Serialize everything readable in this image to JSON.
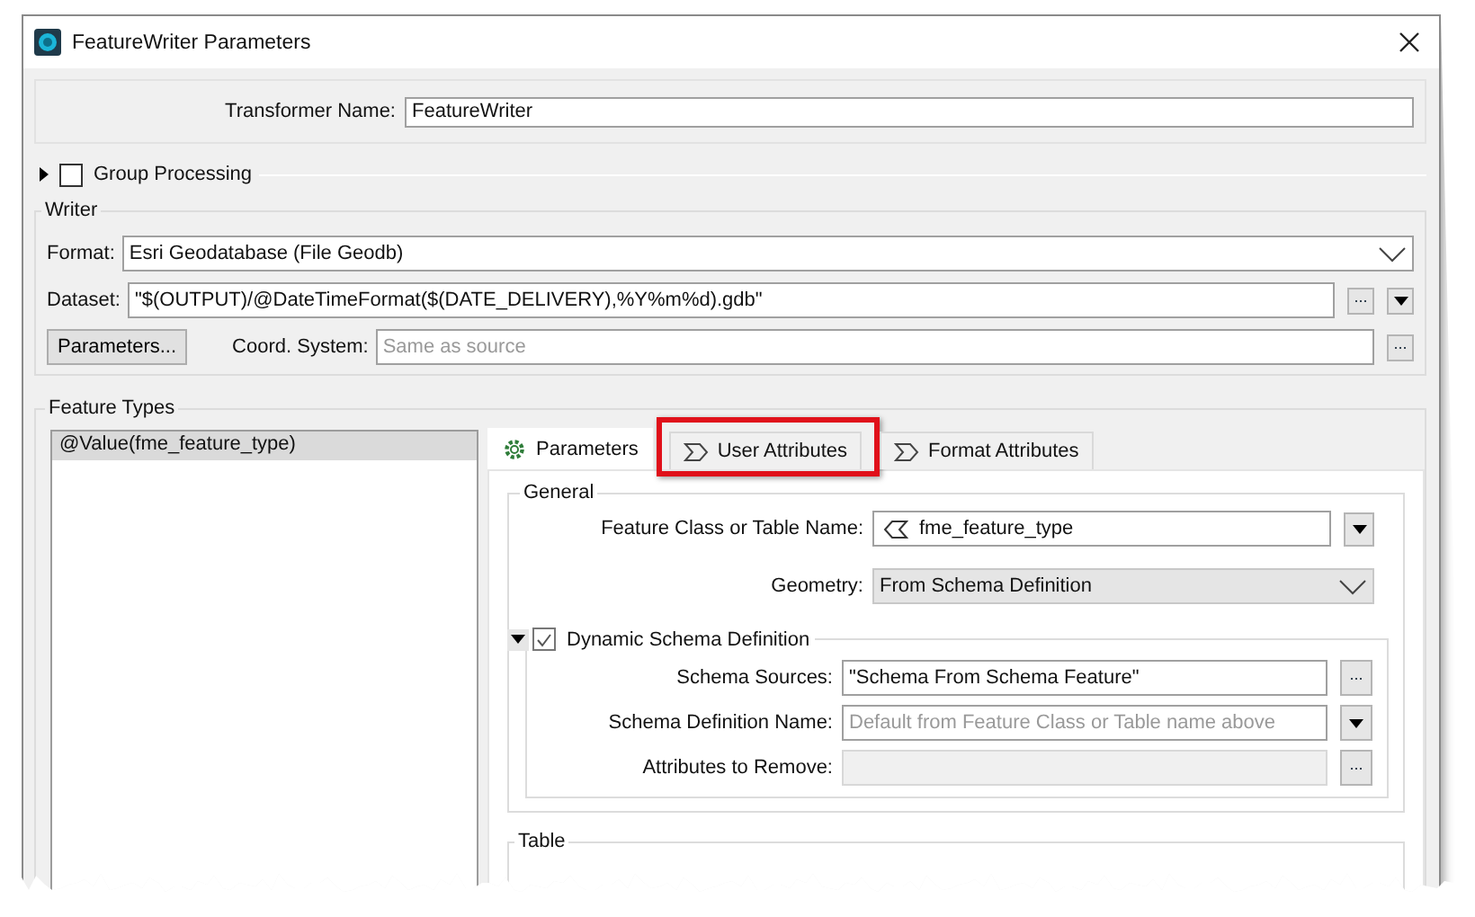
{
  "window": {
    "title": "FeatureWriter Parameters"
  },
  "transformer_name": {
    "label": "Transformer Name:",
    "value": "FeatureWriter"
  },
  "group_processing": {
    "label": "Group Processing",
    "checked": false,
    "expanded": false
  },
  "writer": {
    "title": "Writer",
    "format": {
      "label": "Format:",
      "value": "Esri Geodatabase (File Geodb)",
      "chevron": true
    },
    "dataset": {
      "label": "Dataset:",
      "value": "\"$(OUTPUT)/@DateTimeFormat($(DATE_DELIVERY),%Y%m%d).gdb\"",
      "browse": "...",
      "menu": true
    },
    "parameters_button": "Parameters...",
    "coord_system": {
      "label": "Coord. System:",
      "placeholder": "Same as source",
      "browse": "..."
    }
  },
  "feature_types": {
    "title": "Feature Types",
    "items": [
      {
        "label": "@Value(fme_feature_type)",
        "selected": true
      }
    ],
    "tabs": [
      {
        "label": "Parameters",
        "kind": "settings",
        "selected": true,
        "highlighted": false
      },
      {
        "label": "User Attributes",
        "kind": "attributes",
        "selected": false,
        "highlighted": true
      },
      {
        "label": "Format Attributes",
        "kind": "attributes",
        "selected": false,
        "highlighted": false
      }
    ],
    "general": {
      "title": "General",
      "rows": [
        {
          "label": "Feature Class or Table Name:",
          "value": "fme_feature_type",
          "attribute_icon": true,
          "menu": true,
          "readonly": false
        },
        {
          "label": "Geometry:",
          "value": "From Schema Definition",
          "chevron": true,
          "readonly": true
        }
      ]
    },
    "dynamic_schema": {
      "label": "Dynamic Schema Definition",
      "checked": true,
      "expanded": true,
      "rows": [
        {
          "label": "Schema Sources:",
          "value": "\"Schema From Schema Feature\"",
          "browse": "...",
          "disabled": false
        },
        {
          "label": "Schema Definition Name:",
          "placeholder": "Default from Feature Class or Table name above",
          "menu": true,
          "disabled": false
        },
        {
          "label": "Attributes to Remove:",
          "browse": "...",
          "disabled": true
        }
      ]
    },
    "table": {
      "title": "Table"
    }
  }
}
